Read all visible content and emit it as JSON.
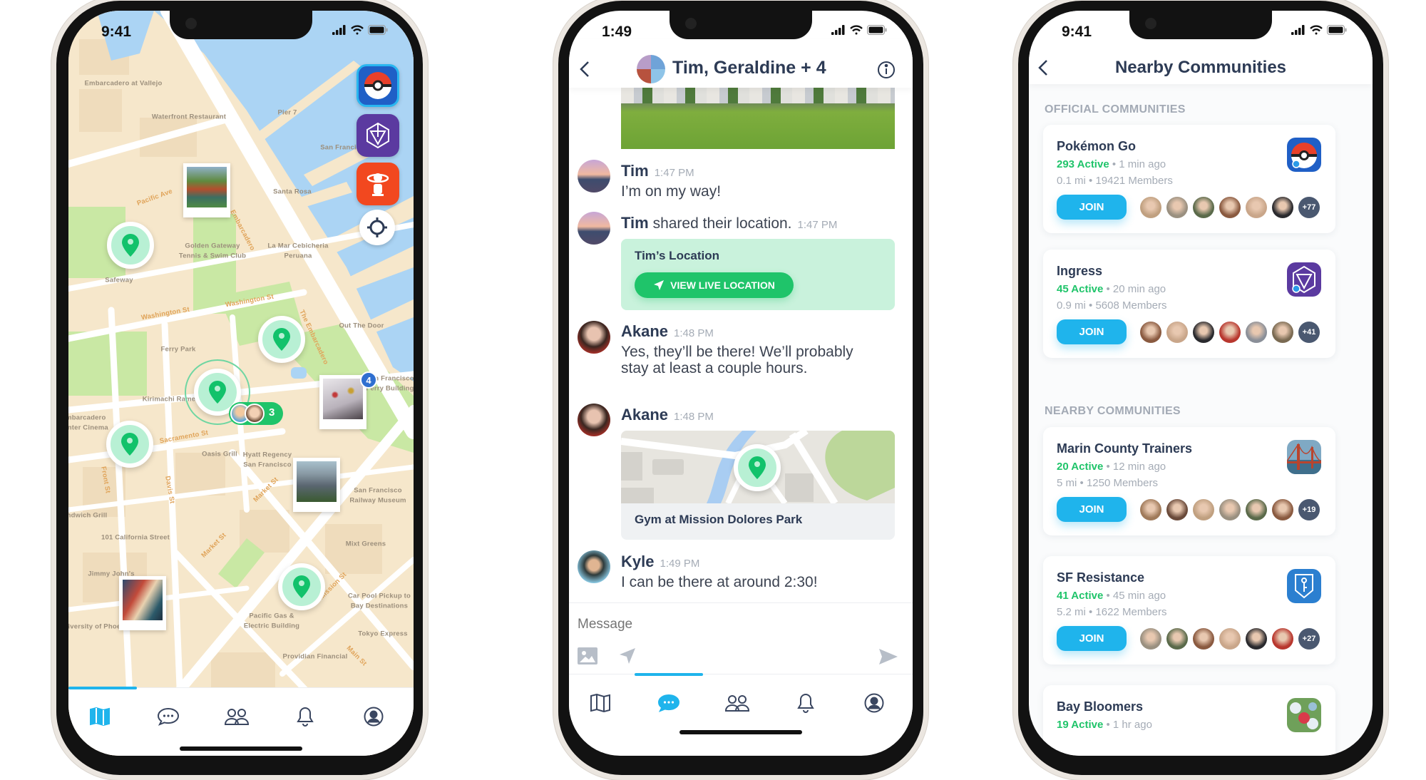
{
  "map_screen": {
    "status_time": "9:41",
    "labels": [
      "Embarcadero at Vallejo",
      "Waterfront Restaurant",
      "Pier 7",
      "San Francisco",
      "Santa Rosa",
      "Pacific Ave",
      "Embarcadero",
      "Golden Gateway",
      "Tennis & Swim Club",
      "La Mar Cebicheria",
      "Peruana",
      "Safeway",
      "Washington St",
      "Washington St",
      "Out The Door",
      "Ferry Park",
      "The Embarcadero",
      "Kirimachi Ramen",
      "Embarcadero",
      "Center Cinema",
      "Sacramento St",
      "Oasis Grill",
      "Hyatt Regency",
      "San Francisco",
      "San Francisco",
      "Railway Museum",
      "Front St",
      "Davis St",
      "Market St",
      "Market St",
      "101 California Street",
      "Mixt Greens",
      "Mission St",
      "Car Pool Pickup to",
      "Bay Destinations",
      "Pacific Gas &",
      "Electric Building",
      "University of Phoenix",
      "Tokyo Express",
      "Main St",
      "Providian Financial",
      "San Francisco",
      "Ferry Building",
      "Jimmy John's",
      "Sandwich Grill"
    ],
    "side_buttons": [
      "pokemon-go-icon",
      "ingress-icon",
      "harry-potter-wizards-unite-icon",
      "locate-me-icon"
    ],
    "group_count": "3",
    "photo_badge": "4",
    "active_tab": "map"
  },
  "chat_screen": {
    "status_time": "1:49",
    "title": "Tim, Geraldine + 4",
    "messages": [
      {
        "author": "Tim",
        "time": "1:47 PM",
        "text": "I’m on my way!"
      },
      {
        "author": "Tim",
        "action": "shared their location.",
        "time": "1:47 PM",
        "card_title": "Tim’s Location",
        "button": "VIEW LIVE LOCATION"
      },
      {
        "author": "Akane",
        "time": "1:48 PM",
        "text_line1": "Yes, they’ll be there! We’ll probably",
        "text_line2": "stay at least a couple hours."
      },
      {
        "author": "Akane",
        "time": "1:48 PM",
        "place": "Gym at Mission Dolores Park"
      },
      {
        "author": "Kyle",
        "time": "1:49 PM",
        "text": "I can be there at around 2:30!"
      }
    ],
    "composer_placeholder": "Message",
    "active_tab": "chat"
  },
  "communities_screen": {
    "status_time": "9:41",
    "title": "Nearby Communities",
    "official_header": "OFFICIAL COMMUNITIES",
    "nearby_header": "NEARBY COMMUNITIES",
    "join_label": "JOIN",
    "official": [
      {
        "name": "Pokémon Go",
        "active": "293 Active",
        "ago": "1 min ago",
        "distance": "0.1 mi",
        "members": "19421 Members",
        "more": "+77",
        "icon": "pokeball-icon"
      },
      {
        "name": "Ingress",
        "active": "45 Active",
        "ago": "20 min ago",
        "distance": "0.9 mi",
        "members": "5608 Members",
        "more": "+41",
        "icon": "ingress-icon"
      }
    ],
    "nearby": [
      {
        "name": "Marin County Trainers",
        "active": "20 Active",
        "ago": "12 min ago",
        "distance": "5 mi",
        "members": "1250 Members",
        "more": "+19",
        "icon": "golden-gate-photo"
      },
      {
        "name": "SF Resistance",
        "active": "41 Active",
        "ago": "45 min ago",
        "distance": "5.2 mi",
        "members": "1622 Members",
        "more": "+27",
        "icon": "resistance-shield-icon"
      },
      {
        "name": "Bay Bloomers",
        "active": "19 Active",
        "ago": "1 hr ago",
        "icon": "pikmin-photo"
      }
    ]
  },
  "tabs": [
    "map",
    "chat",
    "communities",
    "notifications",
    "profile"
  ],
  "colors": {
    "accent_blue": "#1fb4ec",
    "green": "#1fc46a",
    "navy": "#2d3b55",
    "water": "#abd4f4",
    "land": "#f6e7cb",
    "park": "#c9e8a4"
  }
}
